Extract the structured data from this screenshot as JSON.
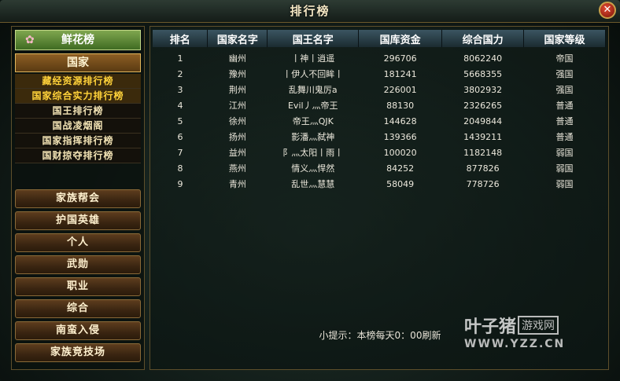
{
  "window": {
    "title": "排行榜",
    "close_label": "✕"
  },
  "sidebar": {
    "flower_tab": "鲜花榜",
    "country_tab": "国家",
    "submenu": [
      "藏经资源排行榜",
      "国家综合实力排行榜",
      "国王排行榜",
      "国战凌烟阁",
      "国家指挥排行榜",
      "国财掠夺排行榜"
    ],
    "buttons": [
      "家族帮会",
      "护国英雄",
      "个人",
      "武勋",
      "职业",
      "综合",
      "南蛮入侵",
      "家族竞技场"
    ]
  },
  "table": {
    "headers": [
      "排名",
      "国家名字",
      "国王名字",
      "国库资金",
      "综合国力",
      "国家等级"
    ],
    "rows": [
      [
        "1",
        "幽州",
        "丨神丨逍遥",
        "296706",
        "8062240",
        "帝国"
      ],
      [
        "2",
        "豫州",
        "丨伊人不回眸丨",
        "181241",
        "5668355",
        "强国"
      ],
      [
        "3",
        "荆州",
        "乱舞川鬼厉a",
        "226001",
        "3802932",
        "强国"
      ],
      [
        "4",
        "江州",
        "Evil丿灬帝王",
        "88130",
        "2326265",
        "普通"
      ],
      [
        "5",
        "徐州",
        "帝王灬QJK",
        "144628",
        "2049844",
        "普通"
      ],
      [
        "6",
        "扬州",
        "影潘灬弑神",
        "139366",
        "1439211",
        "普通"
      ],
      [
        "7",
        "益州",
        "阝灬太阳丨雨丨",
        "100020",
        "1182148",
        "弱国"
      ],
      [
        "8",
        "燕州",
        "情义灬悍然",
        "84252",
        "877826",
        "弱国"
      ],
      [
        "9",
        "青州",
        "乱世灬慧慧",
        "58049",
        "778726",
        "弱国"
      ]
    ]
  },
  "tip": "小提示：本榜每天0：00刷新",
  "watermark": {
    "brand": "叶子猪",
    "game": "游戏网",
    "url": "WWW.YZZ.CN"
  },
  "colors": {
    "active_submenu": "#ffd23a",
    "header_bg": "#2c434c",
    "frame_gold": "#8a6a38"
  }
}
